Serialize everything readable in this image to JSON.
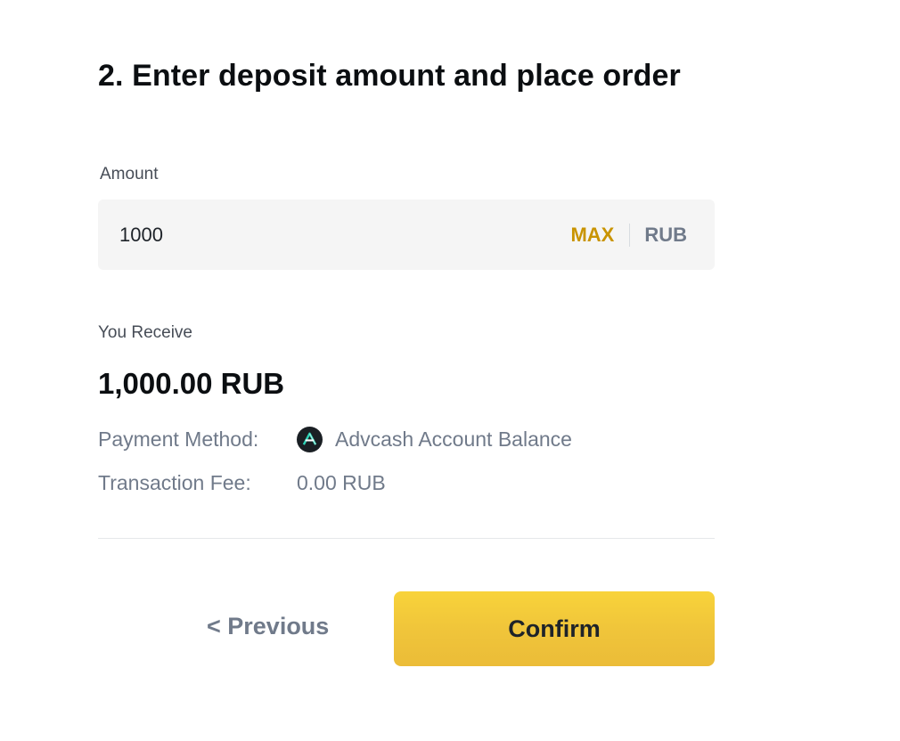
{
  "step": {
    "title": "2. Enter deposit amount and place order"
  },
  "amount": {
    "label": "Amount",
    "value": "1000",
    "max_label": "MAX",
    "currency": "RUB"
  },
  "receive": {
    "label": "You Receive",
    "value": "1,000.00 RUB"
  },
  "details": {
    "payment_method_label": "Payment Method:",
    "payment_method_value": "Advcash Account Balance",
    "payment_method_icon": "advcash-logo-icon",
    "fee_label": "Transaction Fee:",
    "fee_value": "0.00 RUB"
  },
  "actions": {
    "previous_label": "< Previous",
    "confirm_label": "Confirm"
  },
  "colors": {
    "accent": "#c99400",
    "confirm_bg": "#f0c53a",
    "muted_text": "#707a8a",
    "input_bg": "#f5f5f5"
  }
}
